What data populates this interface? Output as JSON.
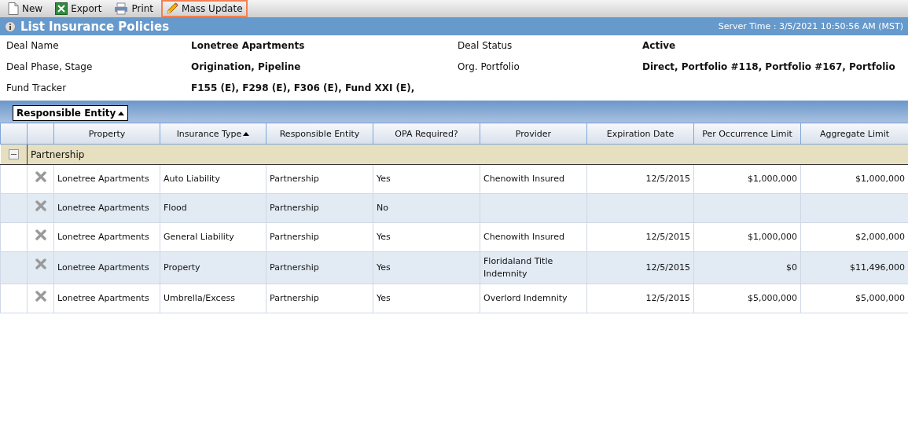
{
  "toolbar": [
    {
      "kind": "new",
      "label": "New",
      "highlighted": false
    },
    {
      "kind": "export",
      "label": "Export",
      "highlighted": false
    },
    {
      "kind": "print",
      "label": "Print",
      "highlighted": false
    },
    {
      "kind": "edit",
      "label": "Mass Update",
      "highlighted": true
    }
  ],
  "title": "List Insurance Policies",
  "server_time": "Server Time : 3/5/2021 10:50:56 AM (MST)",
  "fields": [
    {
      "label": "Deal Name",
      "value": "Lonetree Apartments"
    },
    {
      "label": "Deal Status",
      "value": "Active"
    },
    {
      "label": "Deal Phase, Stage",
      "value": "Origination, Pipeline"
    },
    {
      "label": "Org. Portfolio",
      "value": "Direct, Portfolio #118, Portfolio #167, Portfolio"
    },
    {
      "label": "Fund Tracker",
      "value": "F155 (E), F298 (E), F306 (E), Fund XXI (E),"
    }
  ],
  "grouping": {
    "label": "Responsible Entity",
    "sorted": true
  },
  "table": {
    "columns": [
      {
        "label": "Property",
        "sorted": false,
        "kind": "text"
      },
      {
        "label": "Insurance Type",
        "sorted": true,
        "kind": "text"
      },
      {
        "label": "Responsible Entity",
        "sorted": false,
        "kind": "text"
      },
      {
        "label": "OPA Required?",
        "sorted": false,
        "kind": "text"
      },
      {
        "label": "Provider",
        "sorted": false,
        "kind": "text"
      },
      {
        "label": "Expiration Date",
        "sorted": false,
        "kind": "number"
      },
      {
        "label": "Per Occurrence Limit",
        "sorted": false,
        "kind": "number"
      },
      {
        "label": "Aggregate Limit",
        "sorted": false,
        "kind": "number"
      }
    ],
    "groups": [
      {
        "label": "Partnership",
        "expanded": true,
        "rows": [
          [
            "Lonetree Apartments",
            "Auto Liability",
            "Partnership",
            "Yes",
            "Chenowith Insured",
            "12/5/2015",
            "$1,000,000",
            "$1,000,000"
          ],
          [
            "Lonetree Apartments",
            "Flood",
            "Partnership",
            "No",
            "",
            "",
            "",
            ""
          ],
          [
            "Lonetree Apartments",
            "General Liability",
            "Partnership",
            "Yes",
            "Chenowith Insured",
            "12/5/2015",
            "$1,000,000",
            "$2,000,000"
          ],
          [
            "Lonetree Apartments",
            "Property",
            "Partnership",
            "Yes",
            "Floridaland Title Indemnity",
            "12/5/2015",
            "$0",
            "$11,496,000"
          ],
          [
            "Lonetree Apartments",
            "Umbrella/Excess",
            "Partnership",
            "Yes",
            "Overlord Indemnity",
            "12/5/2015",
            "$5,000,000",
            "$5,000,000"
          ]
        ]
      }
    ]
  }
}
